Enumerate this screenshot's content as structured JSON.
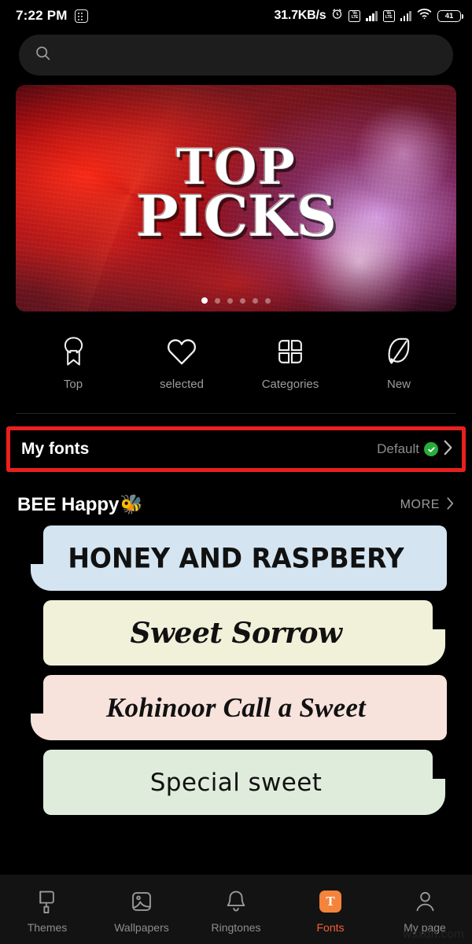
{
  "statusbar": {
    "time": "7:22 PM",
    "dots_icon": "app-grid-icon",
    "network_speed": "31.7KB/s",
    "alarm_icon": "alarm-clock-icon",
    "volte_label_1": "Vo",
    "volte_label_2": "LTE",
    "sim1_icon": "signal-bars-icon",
    "sim2_icon": "signal-bars-icon",
    "wifi_icon": "wifi-icon",
    "battery_level": "41"
  },
  "search": {
    "icon": "search-icon",
    "value": "",
    "placeholder": ""
  },
  "banner": {
    "title_line1": "TOP",
    "title_line2": "PICKS",
    "dot_count": 6,
    "active_dot": 0
  },
  "quicknav": {
    "items": [
      {
        "label": "Top",
        "icon": "award-ribbon-icon"
      },
      {
        "label": "selected",
        "icon": "heart-icon"
      },
      {
        "label": "Categories",
        "icon": "quad-petal-grid-icon"
      },
      {
        "label": "New",
        "icon": "leaf-icon"
      }
    ]
  },
  "my_fonts": {
    "title": "My fonts",
    "value": "Default",
    "check_icon": "green-check-circle-icon",
    "chevron_icon": "chevron-right-icon",
    "highlight_color": "#e8201f"
  },
  "section": {
    "title": "BEE Happy",
    "emoji": "🐝",
    "more_label": "MORE",
    "more_icon": "chevron-right-icon"
  },
  "font_cards": [
    {
      "text": "Honey and Raspbery",
      "bg": "#d4e4f1",
      "notch": "left"
    },
    {
      "text": "Sweet Sorrow",
      "bg": "#f1f0d9",
      "notch": "right"
    },
    {
      "text": "Kohinoor  Call a Sweet",
      "bg": "#f7e2dc",
      "notch": "left"
    },
    {
      "text": "Special sweet",
      "bg": "#dfecdb",
      "notch": "right"
    }
  ],
  "bottomnav": {
    "items": [
      {
        "label": "Themes",
        "icon": "paint-roller-icon",
        "active": false
      },
      {
        "label": "Wallpapers",
        "icon": "image-icon",
        "active": false
      },
      {
        "label": "Ringtones",
        "icon": "bell-icon",
        "active": false
      },
      {
        "label": "Fonts",
        "icon": "font-t-icon",
        "active": true,
        "badge_letter": "T"
      },
      {
        "label": "My page",
        "icon": "person-icon",
        "active": false
      }
    ],
    "active_color": "#f4603b"
  },
  "watermark": {
    "text": "wsxdn.com"
  }
}
